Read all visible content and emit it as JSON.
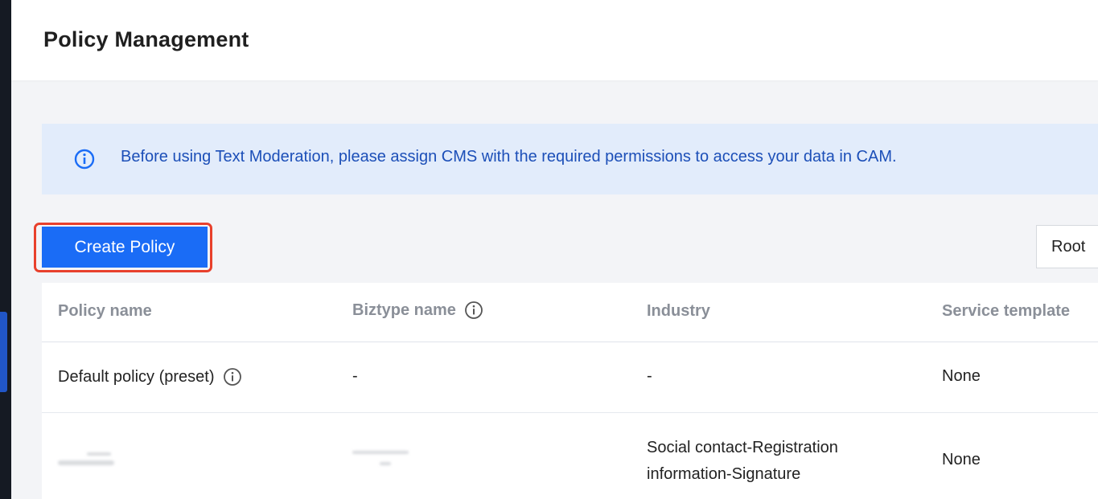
{
  "header": {
    "title": "Policy Management"
  },
  "notice": {
    "icon": "info-icon",
    "text": "Before using Text Moderation, please assign CMS with the required permissions to access your data in CAM.",
    "color": "#1c4fb8"
  },
  "toolbar": {
    "create_label": "Create Policy",
    "scope_value": "Root"
  },
  "table": {
    "columns": {
      "policy_name": "Policy name",
      "biztype_name": "Biztype name",
      "industry": "Industry",
      "service_template": "Service template"
    },
    "rows": [
      {
        "policy_name": "Default policy (preset)",
        "biztype_name": "-",
        "industry": "-",
        "service_template": "None"
      },
      {
        "policy_name": "",
        "biztype_name": "",
        "industry_line1": "Social contact-Registration",
        "industry_line2": "information-Signature",
        "service_template": "None"
      }
    ]
  },
  "colors": {
    "primary": "#1a6cf6",
    "highlight": "#e8402c",
    "notice_bg": "#e2ecfb"
  }
}
